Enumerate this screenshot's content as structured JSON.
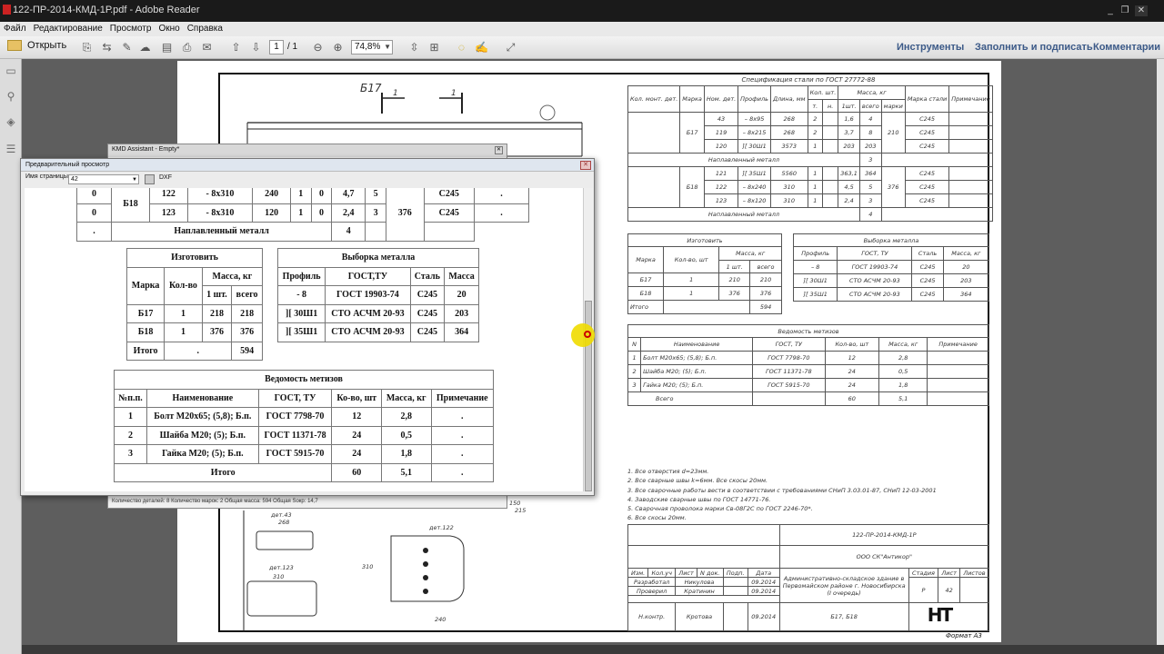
{
  "window": {
    "title": "122-ПР-2014-КМД-1Р.pdf - Adobe Reader"
  },
  "menu": [
    "Файл",
    "Редактирование",
    "Просмотр",
    "Окно",
    "Справка"
  ],
  "toolbar": {
    "open_label": "Открыть",
    "page_current": "1",
    "page_total": "/ 1",
    "zoom": "74,8%"
  },
  "right_links": {
    "tools": "Инструменты",
    "fill_sign": "Заполнить и подписать",
    "comments": "Комментарии"
  },
  "drawing": {
    "marks": {
      "b17": "Б17",
      "d1a": "1",
      "d1b": "1"
    },
    "spec": {
      "title": "Спецификация стали по ГОСТ 27772-88",
      "head1": [
        "Кол. монт. дет.",
        "Марка",
        "Ном. дет.",
        "Профиль",
        "Длина, мм",
        "Кол. шт.",
        "Масса, кг",
        "Марка стали",
        "Примечание"
      ],
      "head2": [
        "т.",
        "н.",
        "1шт.",
        "всего",
        "марки"
      ],
      "b17_rows": [
        [
          "43",
          "– 8х95",
          "268",
          "2",
          "1,6",
          "4",
          "С245"
        ],
        [
          "119",
          "– 8х215",
          "268",
          "2",
          "3,7",
          "8",
          "С245"
        ],
        [
          "120",
          "][ 30Ш1",
          "3573",
          "1",
          "203",
          "203",
          "С245"
        ]
      ],
      "b18_rows": [
        [
          "121",
          "][ 35Ш1",
          "5560",
          "1",
          "363,1",
          "364",
          "С245"
        ],
        [
          "122",
          "– 8х240",
          "310",
          "1",
          "4,5",
          "5",
          "С245"
        ],
        [
          "123",
          "– 8х120",
          "310",
          "1",
          "2,4",
          "3",
          "С245"
        ]
      ],
      "b17_label": "Б17",
      "b17_mass": "210",
      "b18_label": "Б18",
      "b18_mass": "376",
      "weld_label": "Наплавленный металл",
      "weld_b17": "3",
      "weld_b18": "4"
    },
    "make": {
      "title": "Изготовить",
      "head": [
        "Марка",
        "Кол-во, шт",
        "Масса, кг",
        "1 шт.",
        "всего"
      ],
      "rows": [
        [
          "Б17",
          "1",
          "210",
          "210"
        ],
        [
          "Б18",
          "1",
          "376",
          "376"
        ]
      ],
      "total_label": "Итого",
      "total": "594"
    },
    "metal": {
      "title": "Выборка металла",
      "head": [
        "Профиль",
        "ГОСТ, ТУ",
        "Сталь",
        "Масса, кг"
      ],
      "rows": [
        [
          "– 8",
          "ГОСТ 19903-74",
          "С245",
          "20"
        ],
        [
          "][ 30Ш1",
          "СТО АСЧМ 20-93",
          "С245",
          "203"
        ],
        [
          "][ 35Ш1",
          "СТО АСЧМ 20-93",
          "С245",
          "364"
        ]
      ]
    },
    "bolts": {
      "title": "Ведомость метизов",
      "head": [
        "N",
        "Наименование",
        "ГОСТ, ТУ",
        "Кол-во, шт",
        "Масса, кг",
        "Примечание"
      ],
      "rows": [
        [
          "1",
          "Болт М20х65; (5,8); Б.п.",
          "ГОСТ 7798-70",
          "12",
          "2,8"
        ],
        [
          "2",
          "Шайба М20; (5); Б.п.",
          "ГОСТ 11371-78",
          "24",
          "0,5"
        ],
        [
          "3",
          "Гайка М20; (5); Б.п.",
          "ГОСТ 5915-70",
          "24",
          "1,8"
        ]
      ],
      "total_label": "Всего",
      "total_qty": "60",
      "total_mass": "5,1"
    },
    "notes": [
      "1.  Все отверстия d=23мм.",
      "2.  Все сварные швы k=6мм. Все скосы 20мм.",
      "3.  Все сварочные работы вести в соответствии с требованиями СНиП 3.03.01-87, СНиП 12-03-2001",
      "4.  Заводские сварные швы по ГОСТ 14771-76.",
      "5.  Сварочная проволока марки Св-08Г2С по ГОСТ 2246-70*.",
      "6.  Все скосы 20мм."
    ],
    "stamp": {
      "code": "122-ПР-2014-КМД-1Р",
      "org": "ООО СК\"Антикор\"",
      "roles": [
        "Изм.",
        "Кол.уч",
        "Лист",
        "N док.",
        "Подп.",
        "Дата"
      ],
      "dev_label": "Разработал",
      "dev_name": "Никулова",
      "dev_date": "09.2014",
      "chk_label": "Проверил",
      "chk_name": "Кратинин",
      "chk_date": "09.2014",
      "nk_label": "Н.контр.",
      "nk_name": "Кротова",
      "nk_date": "09.2014",
      "project": "Административно-складское здание в Первомайском районе г. Новосибирска (I очередь)",
      "stage_label": "Стадия",
      "sheet_label": "Лист",
      "sheets_label": "Листов",
      "stage": "Р",
      "sheet": "42",
      "marks": "Б17, Б18",
      "logo": "НТ",
      "format": "Формат А3"
    },
    "details": {
      "d43": "дет.43",
      "d43_len": "268",
      "d123": "дет.123",
      "d123_len": "310",
      "d122": "дет.122",
      "d122_len": "310",
      "d122_w": "240",
      "dim150": "150",
      "dim215": "215"
    }
  },
  "kmd": {
    "title": "KMD Assistant - Empty*",
    "status": "Количество деталей: 8    Количество марок: 2    Общая масса: 594    Общая Sокр: 14,7"
  },
  "preview": {
    "title": "Предварительный просмотр",
    "page_label": "Имя страницы",
    "page_value": "42",
    "dxf": "DXF",
    "spec": {
      "rows": [
        [
          "0",
          "122",
          "- 8x310",
          "240",
          "1",
          "0",
          "4,7",
          "5",
          "С245",
          "."
        ],
        [
          "0",
          "123",
          "- 8x310",
          "120",
          "1",
          "0",
          "2,4",
          "3",
          "С245",
          "."
        ]
      ],
      "mark": "Б18",
      "mark_mass": "376",
      "weld_dot": ".",
      "weld": "Наплавленный металл",
      "weld_val": "4"
    },
    "make": {
      "title": "Изготовить",
      "head": [
        "Марка",
        "Кол-во",
        "Масса, кг",
        "1 шт.",
        "всего"
      ],
      "rows": [
        [
          "Б17",
          "1",
          "218",
          "218"
        ],
        [
          "Б18",
          "1",
          "376",
          "376"
        ]
      ],
      "total_label": "Итого",
      "total_dot": ".",
      "total": "594"
    },
    "metal": {
      "title": "Выборка металла",
      "head": [
        "Профиль",
        "ГОСТ,ТУ",
        "Сталь",
        "Масса"
      ],
      "rows": [
        [
          "- 8",
          "ГОСТ 19903-74",
          "С245",
          "20"
        ],
        [
          "][ 30Ш1",
          "СТО АСЧМ 20-93",
          "С245",
          "203"
        ],
        [
          "][ 35Ш1",
          "СТО АСЧМ 20-93",
          "С245",
          "364"
        ]
      ]
    },
    "bolts": {
      "title": "Ведомость метизов",
      "head": [
        "№п.п.",
        "Наименование",
        "ГОСТ, ТУ",
        "Ко-во, шт",
        "Масса, кг",
        "Примечание"
      ],
      "rows": [
        [
          "1",
          "Болт М20х65; (5,8); Б.п.",
          "ГОСТ 7798-70",
          "12",
          "2,8",
          "."
        ],
        [
          "2",
          "Шайба М20; (5); Б.п.",
          "ГОСТ 11371-78",
          "24",
          "0,5",
          "."
        ],
        [
          "3",
          "Гайка М20; (5); Б.п.",
          "ГОСТ 5915-70",
          "24",
          "1,8",
          "."
        ]
      ],
      "total_label": "Итого",
      "total_qty": "60",
      "total_mass": "5,1",
      "total_dot": "."
    }
  }
}
